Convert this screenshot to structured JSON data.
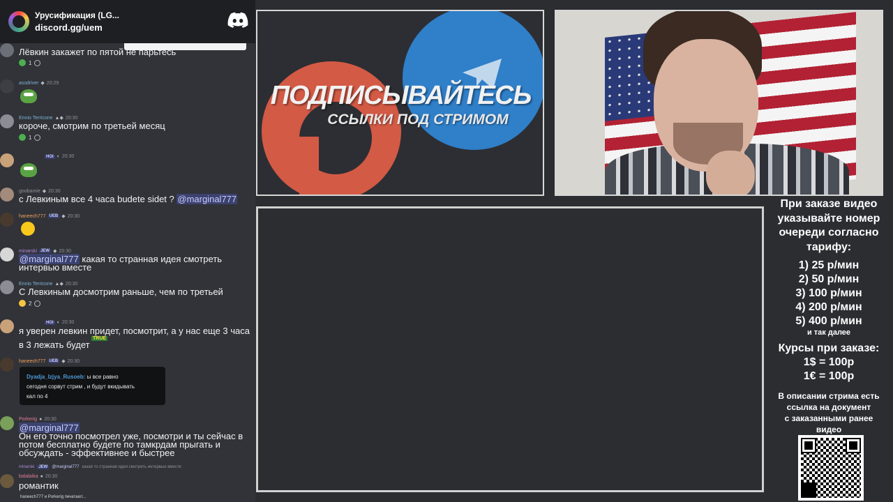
{
  "discord_widget": {
    "server_name": "Урусификация (LG...",
    "invite": "discord.gg/uem"
  },
  "chat": {
    "messages": [
      {
        "text": "Лёвкин закажет по пятой не парьтесь",
        "reaction_count": "1"
      },
      {
        "user": "assdriver",
        "time": "20:29"
      },
      {
        "user": "Ennio Terricone",
        "time": "20:30",
        "text": "короче, смотрим по третьей месяц",
        "reaction_count": "1"
      },
      {
        "tag": "HOI",
        "time": "20:30"
      },
      {
        "user": "goobamie",
        "time": "20:30",
        "text": "с Левкиным все 4 часа budete sidet ?",
        "mention": "@marginal777"
      },
      {
        "user": "haneech777",
        "tag": "UEB",
        "time": "20:30"
      },
      {
        "user": "minarski",
        "tag": "JEW",
        "time": "20:30",
        "mention": "@marginal777",
        "text": "какая то странная идея смотреть",
        "text2": "интервью вместе"
      },
      {
        "user": "Ennio Terricone",
        "time": "20:30",
        "text": "С Левкиным досмотрим раньше, чем по третьей",
        "reaction_count": "2"
      },
      {
        "tag": "HOI",
        "time": "20:30",
        "text": "я уверен левкин придет, посмотрит, а у нас еще 3 часа",
        "text2": "в 3 лежать будет",
        "emote": "TRUE"
      },
      {
        "user": "haneech777",
        "tag": "UEB",
        "time": "20:30",
        "embed_author": "Dyadja_Izjya_Rusoeb:",
        "embed_text1": "ы все равно",
        "embed_text2": "сегодня сорвут стрим , и будут вкидывать",
        "embed_text3": "кал по 4"
      },
      {
        "user": "Porkerig",
        "time": "20:30",
        "mention": "@marginal777",
        "text": "Он его точно посмотрел уже, посмотри и ты сейчас в",
        "text2": "потом бесплатно будете по тамкрдам прыгать и",
        "text3": "обсуждать - эффективнее и быстрее"
      },
      {
        "reply_user": "minarski",
        "reply_tag": "JEW",
        "reply_mention": "@marginal777",
        "reply_text": "какая то странная идея смотреть интервью вместе",
        "user": "balalaika",
        "time": "20:30",
        "text": "романтик"
      }
    ],
    "typing": "haneech777 и Porkerig печатают..."
  },
  "promo": {
    "title": "ПОДПИСЫВАЙТЕСЬ",
    "subtitle": "ССЫЛКИ ПОД СТРИМОМ"
  },
  "info": {
    "intro": [
      "При заказе видео",
      "указывайте номер",
      "очереди согласно",
      "тарифу:"
    ],
    "tariffs": [
      "1) 25 р/мин",
      "2) 50 р/мин",
      "3) 100 р/мин",
      "4) 200 р/мин",
      "5) 400 р/мин"
    ],
    "tariffs_more": "и так далее",
    "rates_title": "Курсы при заказе:",
    "rates": [
      "1$ = 100р",
      "1€ = 100р"
    ],
    "description": [
      "В описании стрима есть",
      "ссылка на документ",
      "с заказанными ранее",
      "видео"
    ]
  },
  "colors": {
    "background": "#2b2d31",
    "chat_background": "#313338",
    "mention": "#c9cdfb",
    "promo_blue": "#2f7fc9",
    "promo_red": "#d35a45"
  }
}
